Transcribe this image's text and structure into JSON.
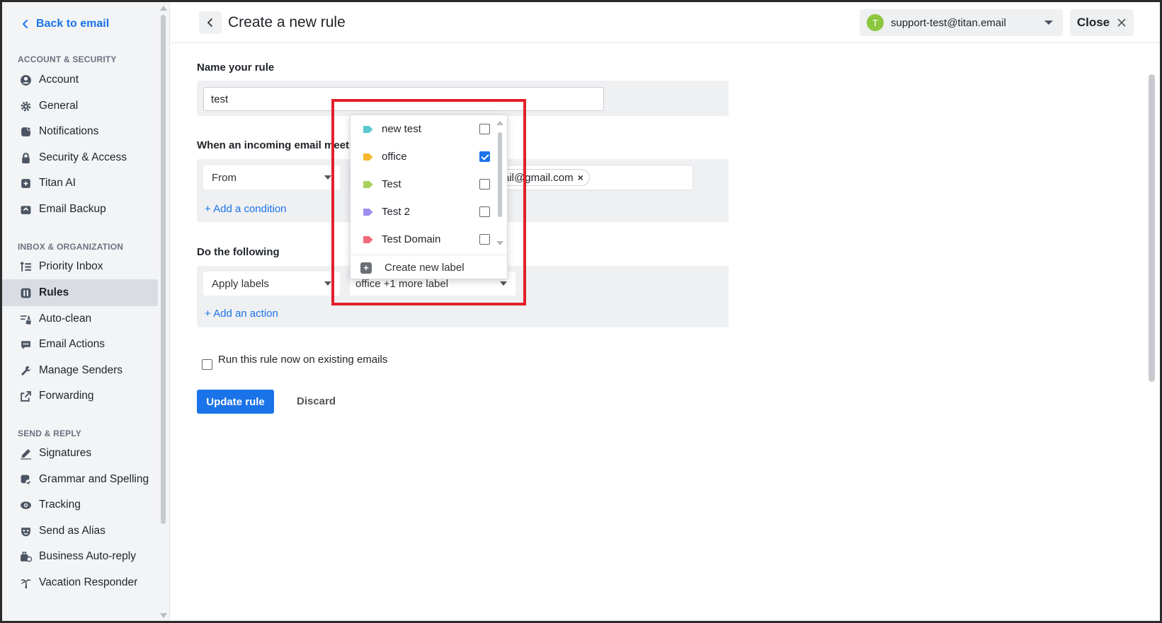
{
  "sidebar": {
    "back_label": "Back to email",
    "sections": {
      "account_security": "ACCOUNT & SECURITY",
      "inbox_org": "INBOX & ORGANIZATION",
      "send_reply": "SEND & REPLY"
    },
    "items": [
      {
        "label": "Account",
        "icon": "user-circle-icon"
      },
      {
        "label": "General",
        "icon": "gear-icon"
      },
      {
        "label": "Notifications",
        "icon": "bell-icon"
      },
      {
        "label": "Security & Access",
        "icon": "lock-icon"
      },
      {
        "label": "Titan AI",
        "icon": "sparkle-icon"
      },
      {
        "label": "Email Backup",
        "icon": "backup-icon"
      },
      {
        "label": "Priority Inbox",
        "icon": "priority-list-icon"
      },
      {
        "label": "Rules",
        "icon": "rules-icon",
        "active": true
      },
      {
        "label": "Auto-clean",
        "icon": "broom-icon"
      },
      {
        "label": "Email Actions",
        "icon": "chat-actions-icon"
      },
      {
        "label": "Manage Senders",
        "icon": "wrench-icon"
      },
      {
        "label": "Forwarding",
        "icon": "forward-icon"
      },
      {
        "label": "Signatures",
        "icon": "pen-icon"
      },
      {
        "label": "Grammar and Spelling",
        "icon": "grammar-icon"
      },
      {
        "label": "Tracking",
        "icon": "eye-icon"
      },
      {
        "label": "Send as Alias",
        "icon": "mask-icon"
      },
      {
        "label": "Business Auto-reply",
        "icon": "auto-reply-icon"
      },
      {
        "label": "Vacation Responder",
        "icon": "palm-tree-icon"
      }
    ]
  },
  "header": {
    "title": "Create a new rule",
    "account_initial": "T",
    "account_email": "support-test@titan.email",
    "close_label": "Close"
  },
  "form": {
    "name_label": "Name your rule",
    "name_value": "test",
    "condition_label": "When an incoming email meets",
    "condition_field": "From",
    "condition_chip": "ail@gmail.com",
    "add_condition": "+ Add a condition",
    "action_label": "Do the following",
    "action_type": "Apply labels",
    "action_value": "office +1 more label",
    "add_action": "+ Add an action",
    "run_existing": "Run this rule now on existing emails",
    "update_button": "Update rule",
    "discard_button": "Discard"
  },
  "label_dropdown": {
    "items": [
      {
        "name": "new test",
        "color": "#5bc8d0",
        "checked": false
      },
      {
        "name": "office",
        "color": "#f5b82e",
        "checked": true
      },
      {
        "name": "Test",
        "color": "#a8d05a",
        "checked": false
      },
      {
        "name": "Test 2",
        "color": "#9c8ff0",
        "checked": false
      },
      {
        "name": "Test Domain",
        "color": "#f26b7a",
        "checked": false
      }
    ],
    "create_label": "Create new label"
  },
  "colors": {
    "accent": "#1a73e8",
    "highlight": "#e3202a",
    "avatar": "#8cc63f"
  }
}
